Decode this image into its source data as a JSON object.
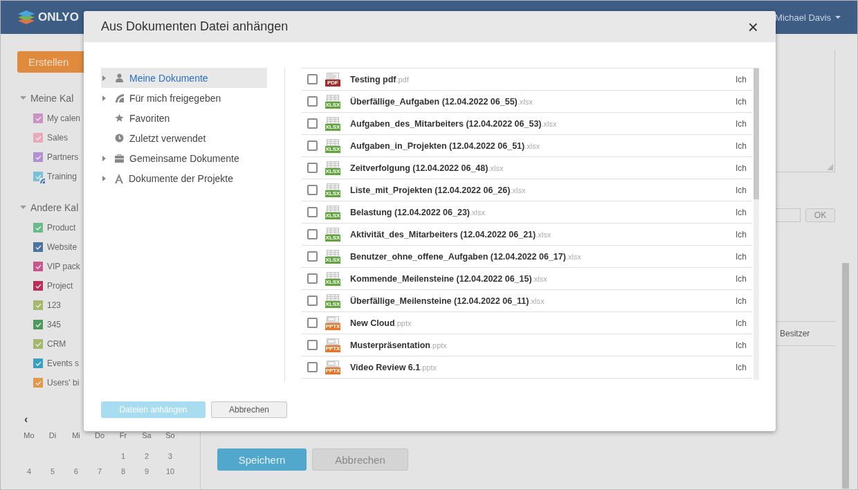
{
  "header": {
    "logo": "ONLYO",
    "user": "Michael Davis"
  },
  "sidebar": {
    "create_button": "Erstellen",
    "groups": [
      {
        "title": "Meine Kal",
        "expanded": true,
        "calendars": [
          {
            "name": "My calen",
            "color": "#c994c4",
            "checked": true,
            "shared": false
          },
          {
            "name": "Sales",
            "color": "#e8aab8",
            "checked": true,
            "shared": false
          },
          {
            "name": "Partners",
            "color": "#b28fd0",
            "checked": true,
            "shared": false
          },
          {
            "name": "Training",
            "color": "#78bfd8",
            "checked": true,
            "shared": true
          }
        ]
      },
      {
        "title": "Andere Kal",
        "expanded": true,
        "calendars": [
          {
            "name": "Product",
            "color": "#6cb98a",
            "checked": true,
            "shared": false
          },
          {
            "name": "Website",
            "color": "#4a74a0",
            "checked": true,
            "shared": false
          },
          {
            "name": "VIP pack",
            "color": "#c8558e",
            "checked": true,
            "shared": false
          },
          {
            "name": "Project",
            "color": "#b8305a",
            "checked": true,
            "shared": false
          },
          {
            "name": "123",
            "color": "#a3b86c",
            "checked": true,
            "shared": false
          },
          {
            "name": "345",
            "color": "#4f9a5a",
            "checked": true,
            "shared": false
          },
          {
            "name": "CRM",
            "color": "#a3b86c",
            "checked": true,
            "shared": false
          },
          {
            "name": "Events s",
            "color": "#3aa0c0",
            "checked": true,
            "shared": false
          },
          {
            "name": "Users' bi",
            "color": "#e0994a",
            "checked": true,
            "shared": false
          }
        ]
      }
    ],
    "mini_calendar": {
      "prev": "‹",
      "weekdays": [
        "Mo",
        "Di",
        "Mi",
        "Do",
        "Fr",
        "Sa",
        "So"
      ],
      "weeks": [
        [
          "1",
          "2",
          "3"
        ],
        [
          "4",
          "5",
          "6",
          "7",
          "8",
          "9",
          "10"
        ]
      ]
    }
  },
  "main": {
    "ok_button": "OK",
    "column_header": "Besitzer",
    "save_button": "Speichern",
    "cancel_button": "Abbrechen"
  },
  "dialog": {
    "title": "Aus Dokumenten Datei anhängen",
    "close": "×",
    "tree": [
      {
        "label": "Meine Dokumente",
        "kind": "person",
        "expandable": true,
        "selected": true
      },
      {
        "label": "Für mich freigegeben",
        "kind": "shared",
        "expandable": true,
        "selected": false
      },
      {
        "label": "Favoriten",
        "kind": "star",
        "expandable": false,
        "selected": false
      },
      {
        "label": "Zuletzt verwendet",
        "kind": "clock",
        "expandable": false,
        "selected": false
      },
      {
        "label": "Gemeinsame Dokumente",
        "kind": "case",
        "expandable": true,
        "selected": false
      },
      {
        "label": "Dokumente der Projekte",
        "kind": "project",
        "expandable": true,
        "selected": false
      }
    ],
    "files": [
      {
        "name": "Testing pdf",
        "ext": ".pdf",
        "kind": "document",
        "badge": "PDF",
        "owner": "Ich",
        "checked": false
      },
      {
        "name": "Überfällige_Aufgaben (12.04.2022 06_55)",
        "ext": ".xlsx",
        "kind": "spreadsheet",
        "badge": "XLSX",
        "owner": "Ich",
        "checked": false
      },
      {
        "name": "Aufgaben_des_Mitarbeiters (12.04.2022 06_53)",
        "ext": ".xlsx",
        "kind": "spreadsheet",
        "badge": "XLSX",
        "owner": "Ich",
        "checked": false
      },
      {
        "name": "Aufgaben_in_Projekten (12.04.2022 06_51)",
        "ext": ".xlsx",
        "kind": "spreadsheet",
        "badge": "XLSX",
        "owner": "Ich",
        "checked": false
      },
      {
        "name": "Zeitverfolgung (12.04.2022 06_48)",
        "ext": ".xlsx",
        "kind": "spreadsheet",
        "badge": "XLSX",
        "owner": "Ich",
        "checked": false
      },
      {
        "name": "Liste_mit_Projekten (12.04.2022 06_26)",
        "ext": ".xlsx",
        "kind": "spreadsheet",
        "badge": "XLSX",
        "owner": "Ich",
        "checked": false
      },
      {
        "name": "Belastung (12.04.2022 06_23)",
        "ext": ".xlsx",
        "kind": "spreadsheet",
        "badge": "XLSX",
        "owner": "Ich",
        "checked": false
      },
      {
        "name": "Aktivität_des_Mitarbeiters (12.04.2022 06_21)",
        "ext": ".xlsx",
        "kind": "spreadsheet",
        "badge": "XLSX",
        "owner": "Ich",
        "checked": false
      },
      {
        "name": "Benutzer_ohne_offene_Aufgaben (12.04.2022 06_17)",
        "ext": ".xlsx",
        "kind": "spreadsheet",
        "badge": "XLSX",
        "owner": "Ich",
        "checked": false
      },
      {
        "name": "Kommende_Meilensteine (12.04.2022 06_15)",
        "ext": ".xlsx",
        "kind": "spreadsheet",
        "badge": "XLSX",
        "owner": "Ich",
        "checked": false
      },
      {
        "name": "Überfällige_Meilensteine (12.04.2022 06_11)",
        "ext": ".xlsx",
        "kind": "spreadsheet",
        "badge": "XLSX",
        "owner": "Ich",
        "checked": false
      },
      {
        "name": "New Cloud",
        "ext": ".pptx",
        "kind": "presentation",
        "badge": "PPTX",
        "owner": "Ich",
        "checked": false
      },
      {
        "name": "Musterpräsentation",
        "ext": ".pptx",
        "kind": "presentation",
        "badge": "PPTX",
        "owner": "Ich",
        "checked": false
      },
      {
        "name": "Video Review 6.1",
        "ext": ".pptx",
        "kind": "presentation",
        "badge": "PPTX",
        "owner": "Ich",
        "checked": false
      }
    ],
    "attach_button": {
      "label": "Dateien anhängen",
      "disabled": true
    },
    "cancel_button": "Abbrechen"
  }
}
